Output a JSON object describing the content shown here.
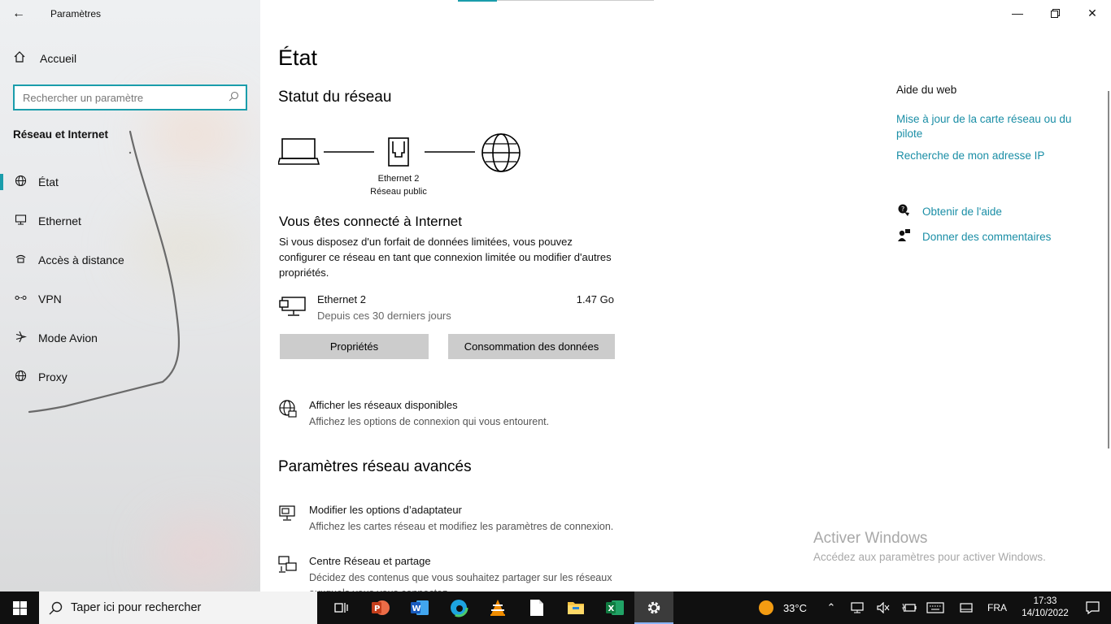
{
  "window": {
    "title": "Paramètres"
  },
  "sidebar": {
    "home_label": "Accueil",
    "search_placeholder": "Rechercher un paramètre",
    "section_heading": "Réseau et Internet",
    "items": [
      {
        "label": "État",
        "icon": "globe-status-icon",
        "active": true
      },
      {
        "label": "Ethernet",
        "icon": "ethernet-icon",
        "active": false
      },
      {
        "label": "Accès à distance",
        "icon": "dialup-icon",
        "active": false
      },
      {
        "label": "VPN",
        "icon": "vpn-icon",
        "active": false
      },
      {
        "label": "Mode Avion",
        "icon": "airplane-icon",
        "active": false
      },
      {
        "label": "Proxy",
        "icon": "proxy-globe-icon",
        "active": false
      }
    ]
  },
  "main": {
    "page_title": "État",
    "network_status_heading": "Statut du réseau",
    "diagram": {
      "adapter_name": "Ethernet 2",
      "network_type": "Réseau public"
    },
    "connected_title": "Vous êtes connecté à Internet",
    "connected_desc": "Si vous disposez d'un forfait de données limitées, vous pouvez configurer ce réseau en tant que connexion limitée ou modifier d'autres propriétés.",
    "adapter": {
      "name": "Ethernet 2",
      "period": "Depuis ces 30 derniers jours",
      "usage": "1.47 Go"
    },
    "properties_button": "Propriétés",
    "data_usage_button": "Consommation des données",
    "show_networks": {
      "title": "Afficher les réseaux disponibles",
      "desc": "Affichez les options de connexion qui vous entourent."
    },
    "advanced_heading": "Paramètres réseau avancés",
    "change_adapter": {
      "title": "Modifier les options d’adaptateur",
      "desc": "Affichez les cartes réseau et modifiez les paramètres de connexion."
    },
    "network_center": {
      "title": "Centre Réseau et partage",
      "desc": "Décidez des contenus que vous souhaitez partager sur les réseaux auxquels vous vous connectez."
    }
  },
  "side": {
    "web_help_heading": "Aide du web",
    "links": [
      "Mise à jour de la carte réseau ou du pilote",
      "Recherche de mon adresse IP"
    ],
    "get_help": "Obtenir de l'aide",
    "feedback": "Donner des commentaires"
  },
  "activation": {
    "title": "Activer Windows",
    "desc": "Accédez aux paramètres pour activer Windows."
  },
  "taskbar": {
    "search_placeholder": "Taper ici pour rechercher",
    "temperature": "33°C",
    "language": "FRA",
    "time": "17:33",
    "date": "14/10/2022"
  },
  "colors": {
    "accent": "#1a9dab",
    "link": "#1a8ea6",
    "taskbar": "#101010"
  }
}
